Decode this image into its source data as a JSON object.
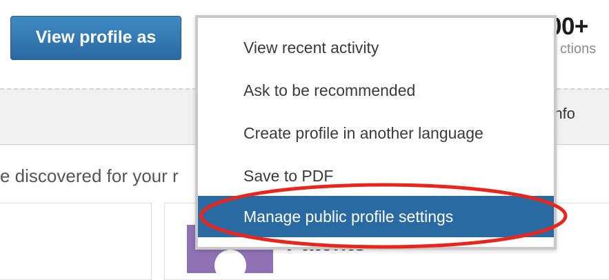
{
  "profile": {
    "view_profile_as_label": "View profile as",
    "connections_count": "00+",
    "connections_label": "ctions"
  },
  "tabs": {
    "partial_contact_info": "t Info"
  },
  "content": {
    "discover_text": "e discovered for your r",
    "patents_title": "Patents"
  },
  "menu": {
    "items": [
      {
        "label": "View recent activity"
      },
      {
        "label": "Ask to be recommended"
      },
      {
        "label": "Create profile in another language"
      },
      {
        "label": "Save to PDF"
      },
      {
        "label": "Manage public profile settings",
        "highlighted": true
      }
    ]
  },
  "colors": {
    "accent_blue": "#2a6aa3",
    "highlight_red": "#e8261c",
    "patent_purple": "#8e72b4"
  },
  "annotation": {
    "shape": "red-ellipse",
    "target": "Manage public profile settings"
  }
}
